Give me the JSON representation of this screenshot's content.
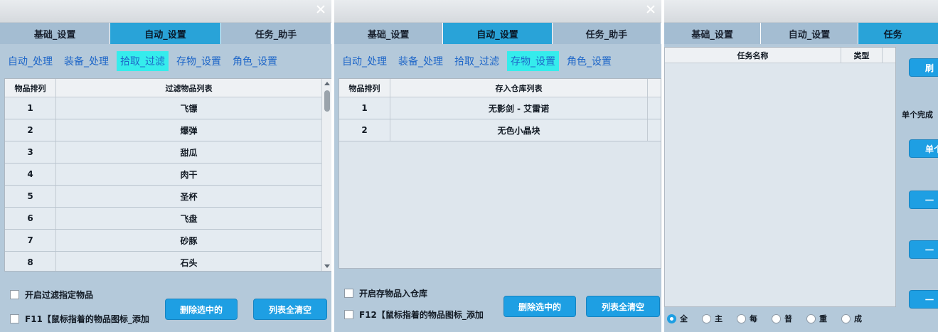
{
  "top_tabs": [
    "基础_设置",
    "自动_设置",
    "任务_助手"
  ],
  "sub_tabs": [
    "自动_处理",
    "装备_处理",
    "拾取_过滤",
    "存物_设置",
    "角色_设置"
  ],
  "window1": {
    "table": {
      "col_index": "物品排列",
      "col_items": "过滤物品列表",
      "rows": [
        {
          "index": "1",
          "name": "飞镖"
        },
        {
          "index": "2",
          "name": "爆弹"
        },
        {
          "index": "3",
          "name": "甜瓜"
        },
        {
          "index": "4",
          "name": "肉干"
        },
        {
          "index": "5",
          "name": "圣杯"
        },
        {
          "index": "6",
          "name": "飞盘"
        },
        {
          "index": "7",
          "name": "砂豚"
        },
        {
          "index": "8",
          "name": "石头"
        }
      ]
    },
    "checkbox1": "开启过滤指定物品",
    "checkbox2": "F11【鼠标指着的物品图标_添加",
    "btn_delete": "删除选中的",
    "btn_clear": "列表全清空"
  },
  "window2": {
    "table": {
      "col_index": "物品排列",
      "col_items": "存入仓库列表",
      "rows": [
        {
          "index": "1",
          "name": "无影剑 - 艾雷诺"
        },
        {
          "index": "2",
          "name": "无色小晶块"
        }
      ]
    },
    "checkbox1": "开启存物品入仓库",
    "checkbox2": "F12【鼠标指着的物品图标_添加",
    "btn_delete": "删除选中的",
    "btn_clear": "列表全清空"
  },
  "window3": {
    "top_tabs": [
      "基础_设置",
      "自动_设置",
      "任务"
    ],
    "table": {
      "col_name": "任务名称",
      "col_type": "类型"
    },
    "side_label": "单个完成",
    "side_buttons": [
      "刷",
      "单个",
      "一",
      "一",
      "一"
    ],
    "radios": [
      "全",
      "主",
      "每",
      "普",
      "重",
      "成"
    ]
  },
  "colors": {
    "accent": "#1e9fe3",
    "active_tab": "#29a3d8",
    "sub_tab_active": "#35ecec",
    "panel": "#b4c9da"
  }
}
